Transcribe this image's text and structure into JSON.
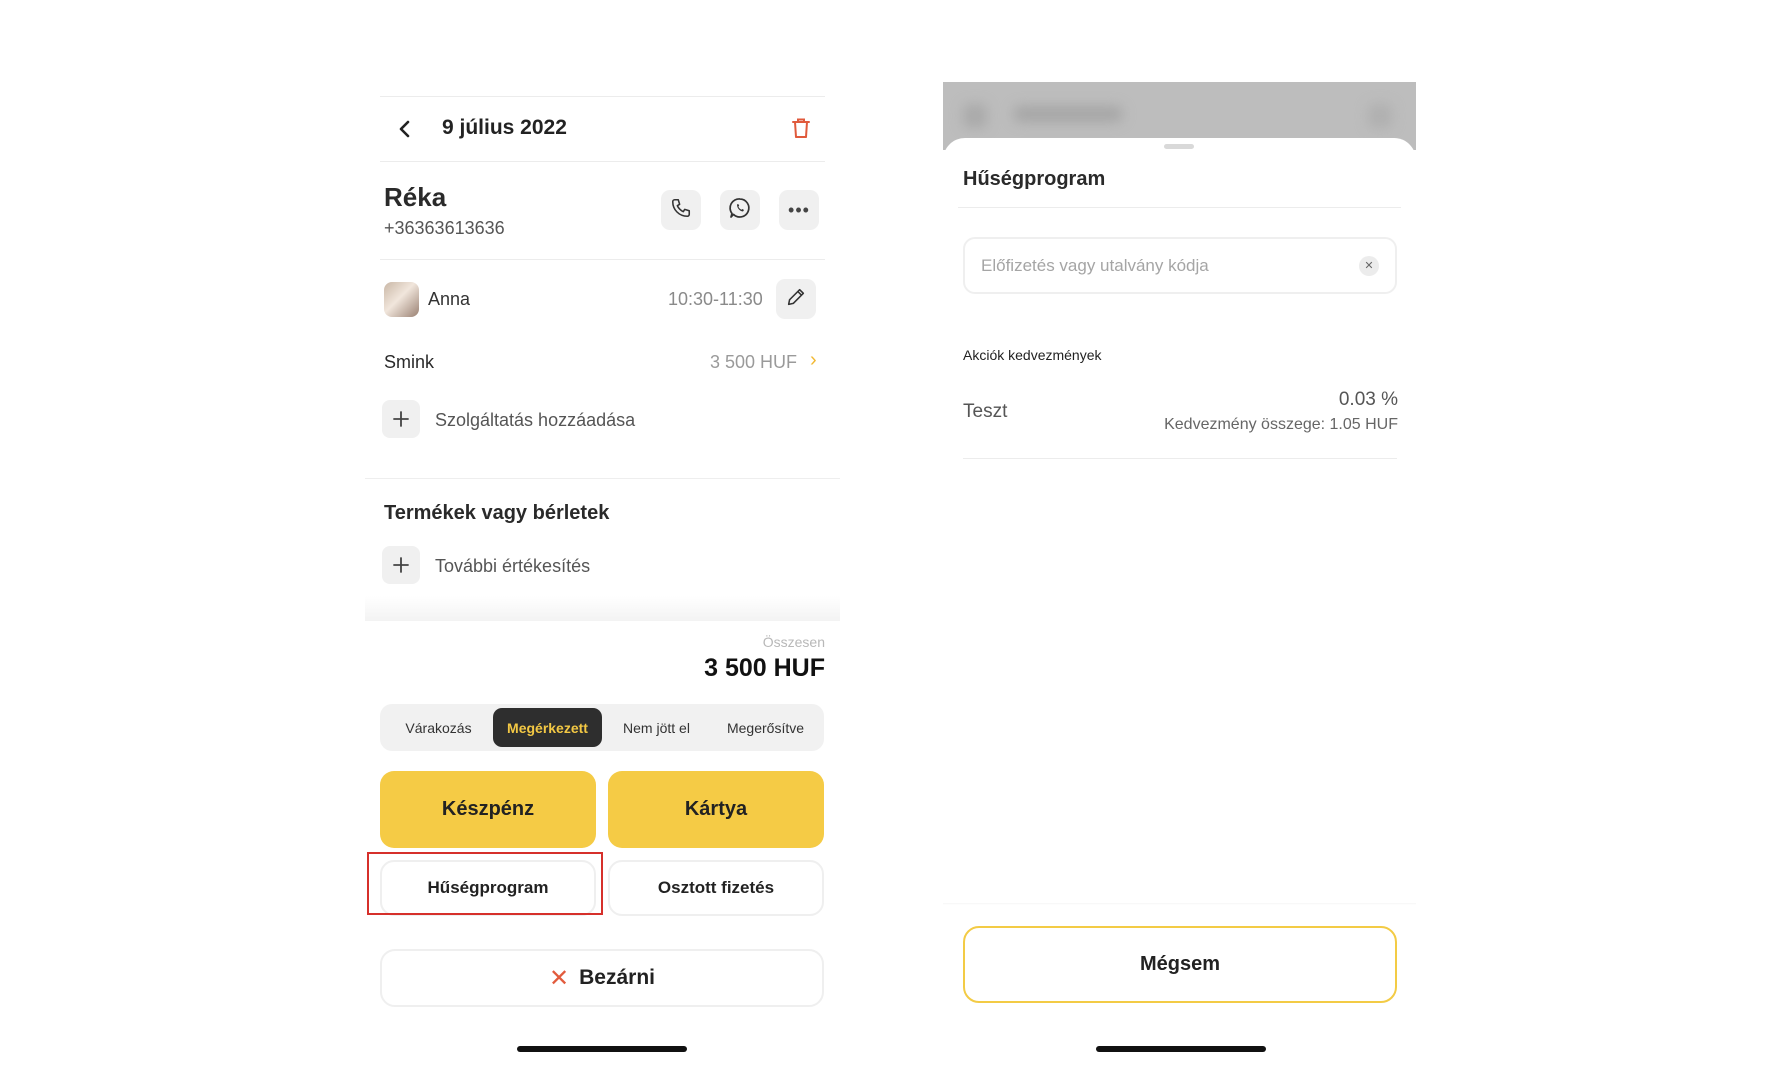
{
  "left": {
    "header": {
      "date_title": "9 július 2022"
    },
    "client": {
      "name": "Réka",
      "phone": "+36363613636"
    },
    "staff": {
      "name": "Anna",
      "time": "10:30-11:30"
    },
    "service": {
      "name": "Smink",
      "price": "3 500 HUF",
      "add_label": "Szolgáltatás hozzáadása"
    },
    "products": {
      "title": "Termékek vagy bérletek",
      "add_label": "További értékesítés"
    },
    "total": {
      "label": "Összesen",
      "value": "3 500 HUF"
    },
    "status_tabs": [
      {
        "label": "Várakozás",
        "active": false
      },
      {
        "label": "Megérkezett",
        "active": true
      },
      {
        "label": "Nem jött el",
        "active": false
      },
      {
        "label": "Megerősítve",
        "active": false
      }
    ],
    "payment": {
      "cash": "Készpénz",
      "card": "Kártya",
      "loyalty": "Hűségprogram",
      "split": "Osztott fizetés"
    },
    "close_label": "Bezárni"
  },
  "right": {
    "sheet_title": "Hűségprogram",
    "code_input": {
      "placeholder": "Előfizetés vagy utalvány kódja",
      "value": ""
    },
    "promos_heading": "Akciók kedvezmények",
    "promo": {
      "name": "Teszt",
      "percent": "0.03 %",
      "amount": "Kedvezmény összege: 1.05 HUF"
    },
    "cancel_label": "Mégsem"
  },
  "colors": {
    "accent": "#f5cb45",
    "highlight": "#d6302b",
    "dark": "#2e2e2e",
    "close_x": "#e25b3d"
  }
}
